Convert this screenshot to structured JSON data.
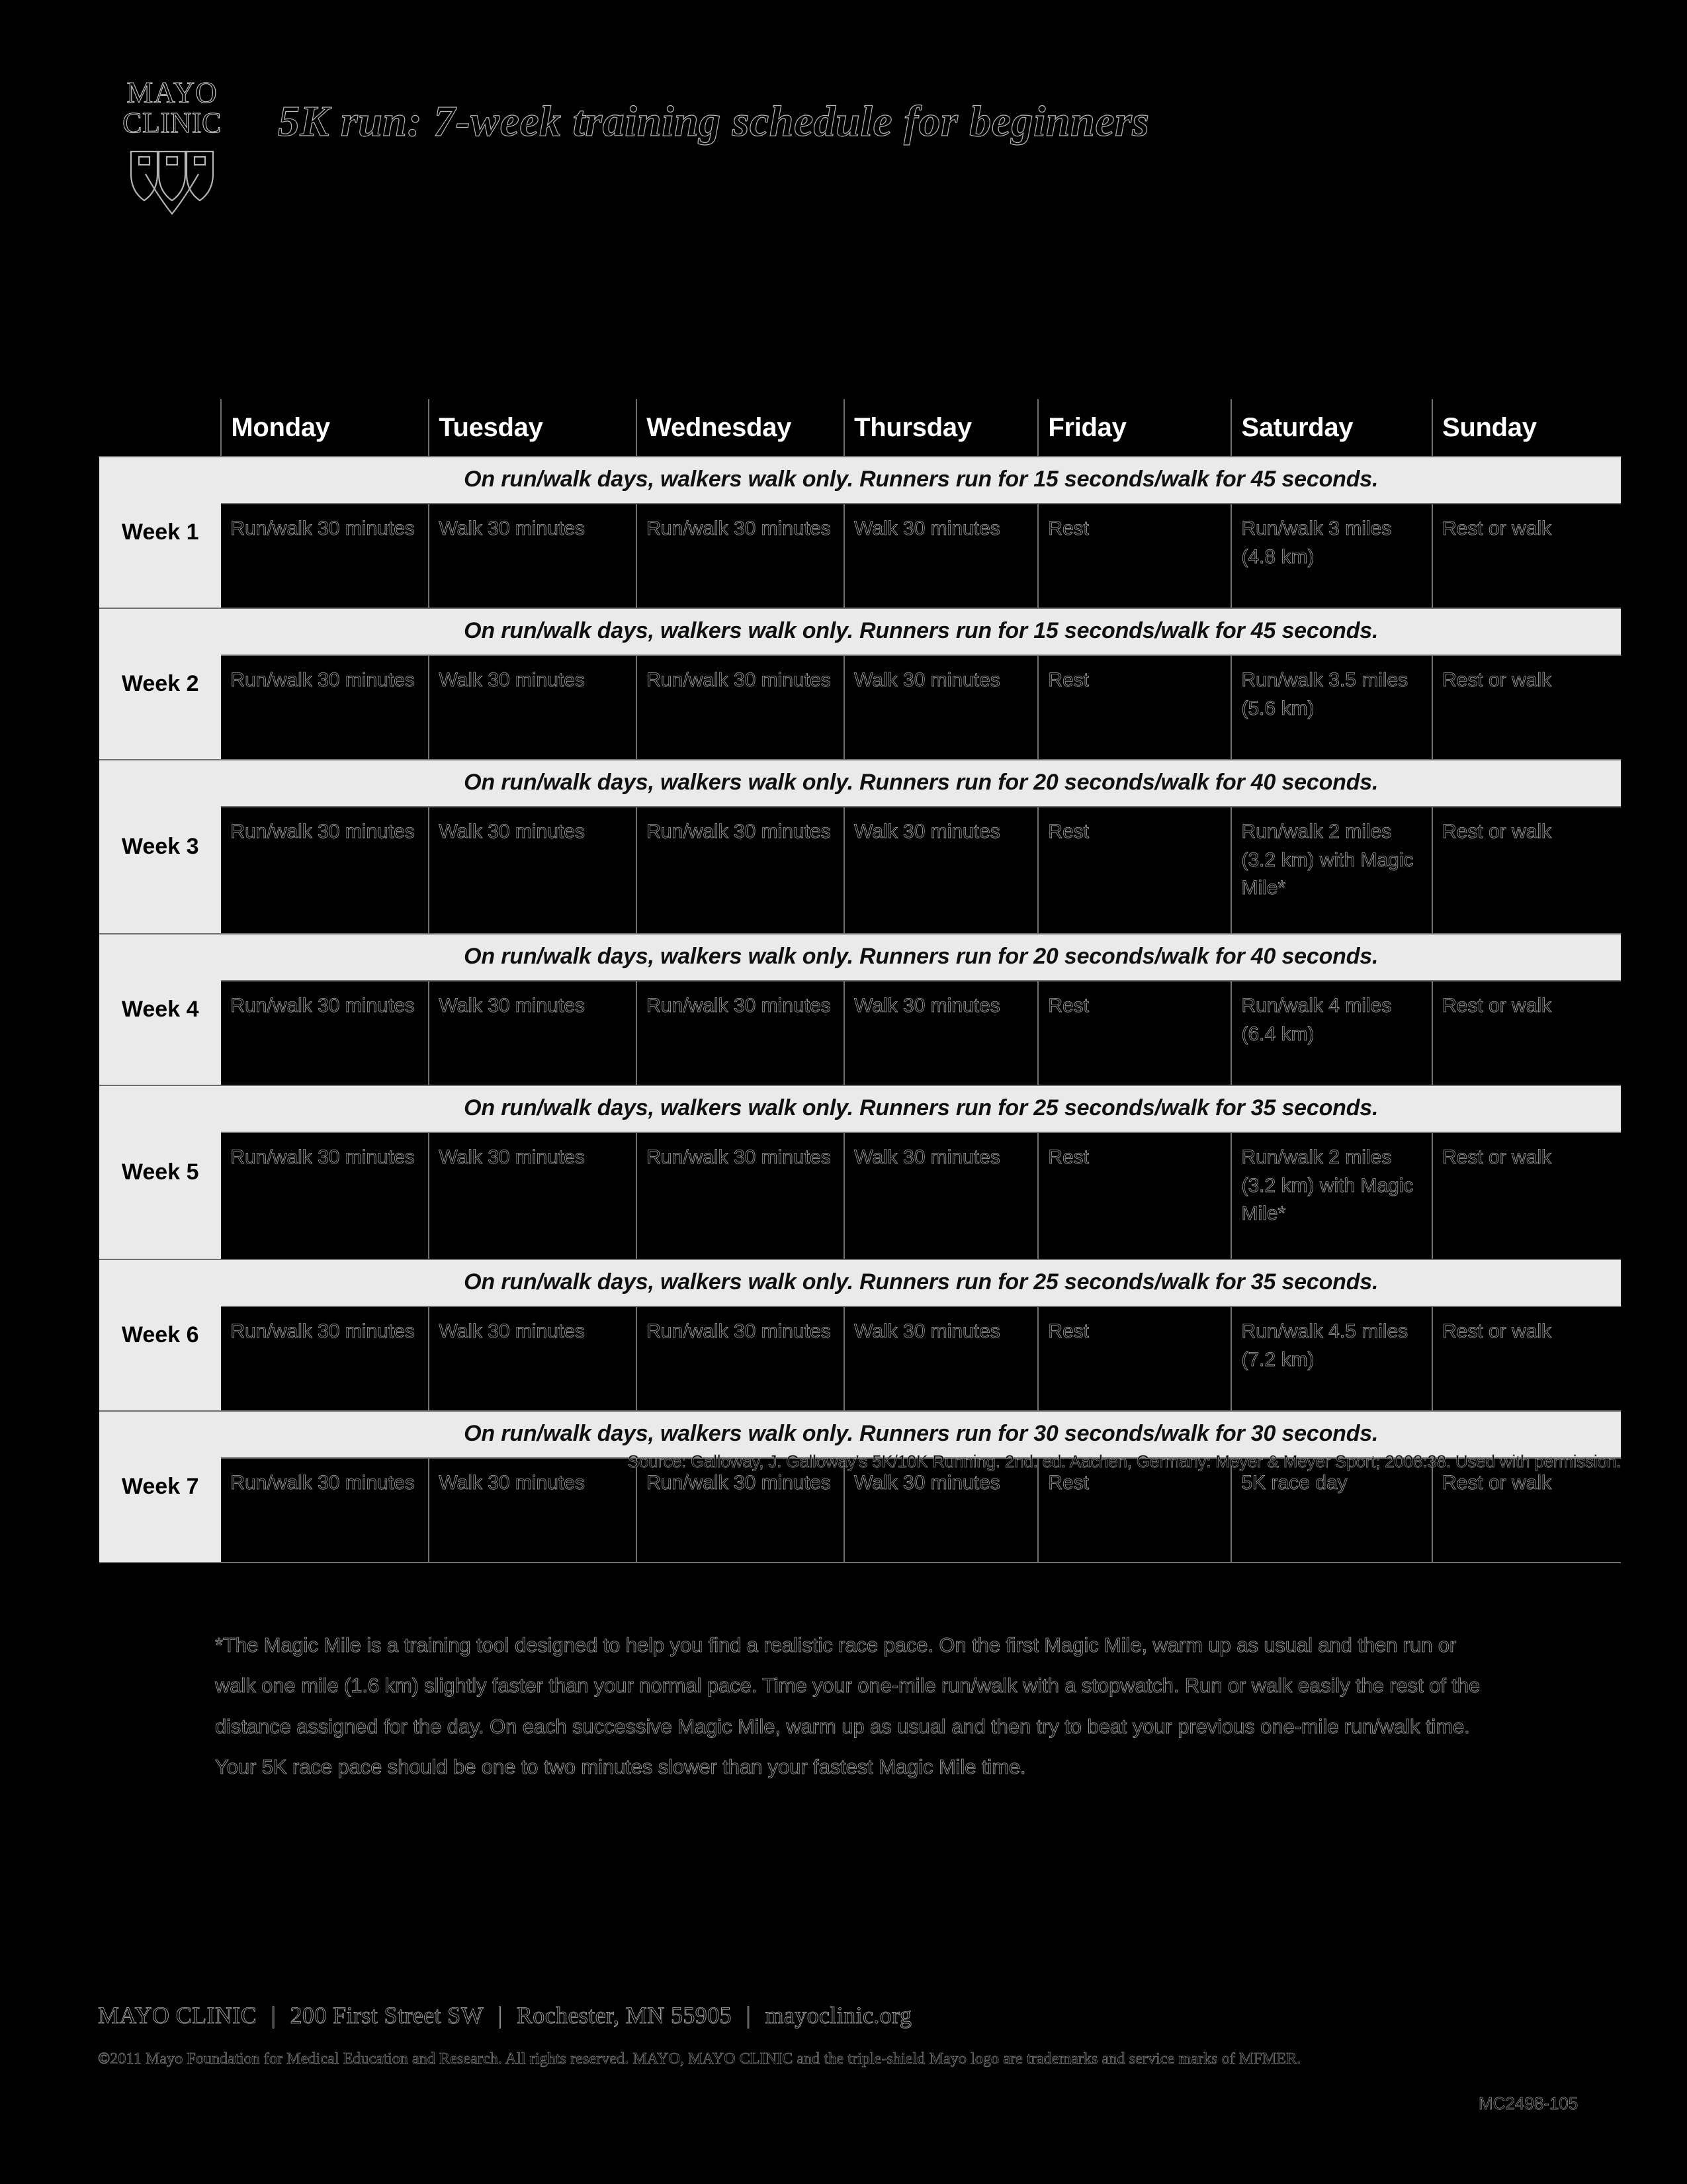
{
  "brand": {
    "logo_line1": "MAYO",
    "logo_line2": "CLINIC",
    "logo_icon": "triple-shield-icon"
  },
  "header": {
    "title": "5K run: 7-week training schedule for beginners"
  },
  "table": {
    "week_column_header": "",
    "day_headers": [
      "Monday",
      "Tuesday",
      "Wednesday",
      "Thursday",
      "Friday",
      "Saturday",
      "Sunday"
    ],
    "weeks": [
      {
        "label": "Week 1",
        "note": "On run/walk days, walkers walk only. Runners run for 15 seconds/walk for 45 seconds.",
        "days": [
          "Run/walk 30 minutes",
          "Walk 30 minutes",
          "Run/walk 30 minutes",
          "Walk 30 minutes",
          "Rest",
          "Run/walk 3 miles (4.8 km)",
          "Rest or walk"
        ]
      },
      {
        "label": "Week 2",
        "note": "On run/walk days, walkers walk only. Runners run for 15 seconds/walk for 45 seconds.",
        "days": [
          "Run/walk 30 minutes",
          "Walk 30 minutes",
          "Run/walk 30 minutes",
          "Walk 30 minutes",
          "Rest",
          "Run/walk 3.5 miles (5.6 km)",
          "Rest or walk"
        ]
      },
      {
        "label": "Week 3",
        "note": "On run/walk days, walkers walk only. Runners run for 20 seconds/walk for 40 seconds.",
        "days": [
          "Run/walk 30 minutes",
          "Walk 30 minutes",
          "Run/walk 30 minutes",
          "Walk 30 minutes",
          "Rest",
          "Run/walk 2 miles (3.2 km) with Magic Mile*",
          "Rest or walk"
        ],
        "tall": true
      },
      {
        "label": "Week 4",
        "note": "On run/walk days, walkers walk only. Runners run for 20 seconds/walk for 40 seconds.",
        "days": [
          "Run/walk 30 minutes",
          "Walk 30 minutes",
          "Run/walk 30 minutes",
          "Walk 30 minutes",
          "Rest",
          "Run/walk 4 miles (6.4 km)",
          "Rest or walk"
        ]
      },
      {
        "label": "Week 5",
        "note": "On run/walk days, walkers walk only. Runners run for 25 seconds/walk for 35 seconds.",
        "days": [
          "Run/walk 30 minutes",
          "Walk 30 minutes",
          "Run/walk 30 minutes",
          "Walk 30 minutes",
          "Rest",
          "Run/walk 2 miles (3.2 km) with Magic Mile*",
          "Rest or walk"
        ],
        "tall": true
      },
      {
        "label": "Week 6",
        "note": "On run/walk days, walkers walk only. Runners run for 25 seconds/walk for 35 seconds.",
        "days": [
          "Run/walk 30 minutes",
          "Walk 30 minutes",
          "Run/walk 30 minutes",
          "Walk 30 minutes",
          "Rest",
          "Run/walk 4.5 miles (7.2 km)",
          "Rest or walk"
        ]
      },
      {
        "label": "Week 7",
        "note": "On run/walk days, walkers walk only. Runners run for 30 seconds/walk for 30 seconds.",
        "days": [
          "Run/walk 30 minutes",
          "Walk 30 minutes",
          "Run/walk 30 minutes",
          "Walk 30 minutes",
          "Rest",
          "5K race day",
          "Rest or walk"
        ]
      }
    ]
  },
  "source": "Source: Galloway, J. Galloway's 5K/10K Running. 2nd. ed. Aachen, Germany: Meyer & Meyer Sport; 2008:38. Used with permission.",
  "footnote": "*The Magic Mile is a training tool designed to help you find a realistic race pace. On the first Magic Mile, warm up as usual and then run or walk one mile (1.6 km) slightly faster than your normal pace. Time your one-mile run/walk with a stopwatch. Run or walk easily the rest of the distance assigned for the day. On each successive Magic Mile, warm up as usual and then try to beat your previous one-mile run/walk time. Your 5K race pace should be one to two minutes slower than your fastest Magic Mile time.",
  "footer": {
    "org": "MAYO CLINIC",
    "street": "200 First Street SW",
    "city": "Rochester, MN 55905",
    "website": "mayoclinic.org",
    "separator": "|",
    "copyright": "©2011 Mayo Foundation for Medical Education and Research. All rights reserved. MAYO, MAYO CLINIC and the triple-shield Mayo logo are trademarks and service marks of MFMER.",
    "doc_code": "MC2498-105"
  },
  "colors": {
    "page_background": "#000000",
    "header_row_background": "#000000",
    "header_row_text": "#ffffff",
    "note_row_background": "#eaeaea",
    "note_row_text": "#101010",
    "week_label_background": "#eaeaea",
    "cell_background": "#000000",
    "grid_line": "#6f6f6f",
    "outline_text": "#a8a8a8"
  }
}
